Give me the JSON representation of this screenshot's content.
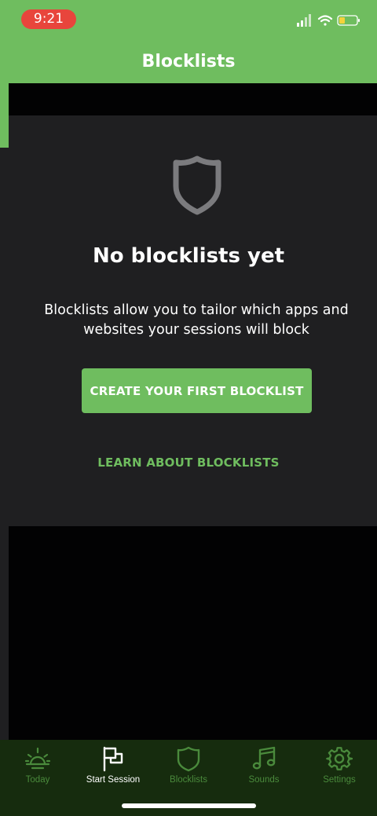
{
  "status_bar": {
    "time": "9:21"
  },
  "header": {
    "title": "Blocklists"
  },
  "empty_state": {
    "icon": "shield-icon",
    "title": "No blocklists yet",
    "description": "Blocklists allow you to tailor which apps and websites your sessions will block",
    "primary_button": "CREATE YOUR FIRST BLOCKLIST",
    "learn_link": "LEARN ABOUT BLOCKLISTS"
  },
  "tabs": [
    {
      "label": "Today",
      "icon": "sunrise-icon",
      "active": false
    },
    {
      "label": "Start Session",
      "icon": "flag-icon",
      "active": true
    },
    {
      "label": "Blocklists",
      "icon": "shield-icon",
      "active": false
    },
    {
      "label": "Sounds",
      "icon": "music-note-icon",
      "active": false
    },
    {
      "label": "Settings",
      "icon": "gear-icon",
      "active": false
    }
  ],
  "colors": {
    "accent": "#6fbd5f",
    "card_bg": "#1f1f21",
    "page_bg": "#020203",
    "tab_bar_bg": "#162c0e",
    "tab_inactive": "#4a8a3c",
    "time_pill": "#e8453c"
  }
}
